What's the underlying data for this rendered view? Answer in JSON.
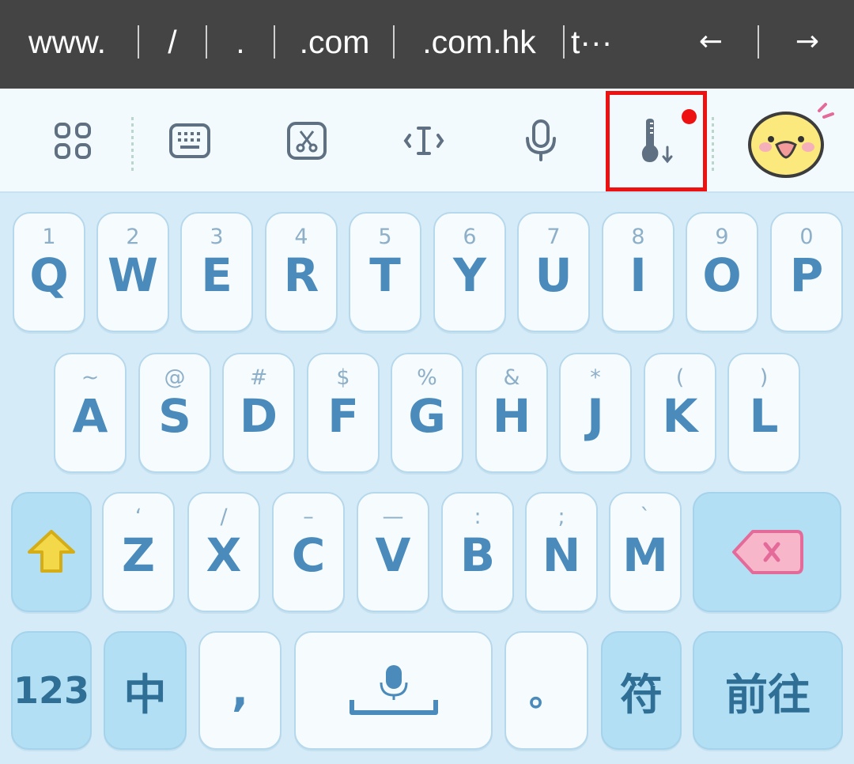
{
  "url_bar": {
    "suggestions": [
      "www.",
      "/",
      ".",
      ".com",
      ".com.hk",
      "t···"
    ],
    "back_arrow": "←",
    "forward_arrow": "→"
  },
  "toolbar": {
    "icons": [
      "apps-grid-icon",
      "keyboard-icon",
      "scissors-clipboard-icon",
      "text-cursor-icon",
      "microphone-icon",
      "thermometer-temperature-icon",
      "chick-sticker-icon"
    ],
    "accent_color": "#ee1111"
  },
  "keyboard": {
    "row1": [
      {
        "sub": "1",
        "main": "Q"
      },
      {
        "sub": "2",
        "main": "W"
      },
      {
        "sub": "3",
        "main": "E"
      },
      {
        "sub": "4",
        "main": "R"
      },
      {
        "sub": "5",
        "main": "T"
      },
      {
        "sub": "6",
        "main": "Y"
      },
      {
        "sub": "7",
        "main": "U"
      },
      {
        "sub": "8",
        "main": "I"
      },
      {
        "sub": "9",
        "main": "O"
      },
      {
        "sub": "0",
        "main": "P"
      }
    ],
    "row2": [
      {
        "sub": "~",
        "main": "A"
      },
      {
        "sub": "@",
        "main": "S"
      },
      {
        "sub": "#",
        "main": "D"
      },
      {
        "sub": "$",
        "main": "F"
      },
      {
        "sub": "%",
        "main": "G"
      },
      {
        "sub": "&",
        "main": "H"
      },
      {
        "sub": "*",
        "main": "J"
      },
      {
        "sub": "(",
        "main": "K"
      },
      {
        "sub": ")",
        "main": "L"
      }
    ],
    "row3": [
      {
        "sub": "ʻ",
        "main": "Z"
      },
      {
        "sub": "/",
        "main": "X"
      },
      {
        "sub": "–",
        "main": "C"
      },
      {
        "sub": "—",
        "main": "V"
      },
      {
        "sub": ":",
        "main": "B"
      },
      {
        "sub": ";",
        "main": "N"
      },
      {
        "sub": "ˋ",
        "main": "M"
      }
    ],
    "bottom": {
      "numbers": "123",
      "language": "中",
      "comma": ",",
      "period": "。",
      "symbols": "符",
      "go": "前往"
    },
    "shift_color": "#f3d94a",
    "delete_color": "#f7b6c9"
  }
}
